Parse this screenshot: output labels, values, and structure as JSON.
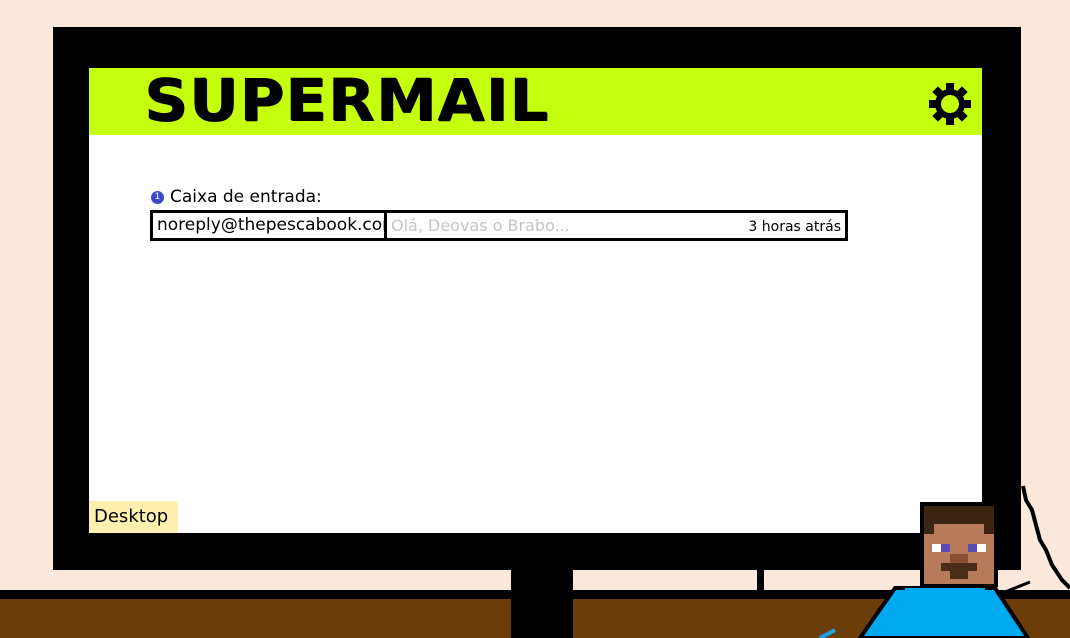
{
  "app": {
    "logo_text": "SUPERMAIL",
    "settings_icon": "gear-icon"
  },
  "inbox": {
    "unread_count": "1",
    "label": "Caixa de entrada:",
    "messages": [
      {
        "sender": "noreply@thepescabook.com",
        "subject": "Olá, Deovas o Brabo...",
        "time": "3 horas atrás"
      }
    ]
  },
  "desktop_button": {
    "label": "Desktop"
  },
  "colors": {
    "header": "#c6ff0e",
    "wall": "#fde8dc",
    "desk": "#6a3d09",
    "badge": "#3b49c9",
    "desktop_button": "#fff0b0"
  }
}
